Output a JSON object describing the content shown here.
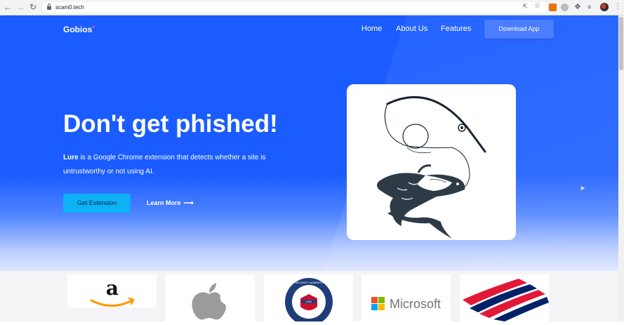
{
  "browser": {
    "url": "scam0.tech",
    "icons": [
      "back-icon",
      "forward-icon",
      "reload-icon",
      "lock-icon",
      "share-icon",
      "star-icon",
      "extension-icon",
      "puzzle-icon",
      "media-icon",
      "avatar",
      "menu-icon"
    ]
  },
  "nav": {
    "logo": "Gobios",
    "logo_mark": "*",
    "links": [
      "Home",
      "About Us",
      "Features"
    ],
    "download_label": "Download App"
  },
  "hero": {
    "headline": "Don't get phished!",
    "desc_bold": "Lure",
    "desc_rest": " is a Google Chrome extension that detects whether a site is untrustworthy or not using AI.",
    "primary_button": "Get Extension",
    "secondary_link": "Learn More",
    "image": "fishing-hook-fish-illustration"
  },
  "partners": {
    "microsoft_label": "Microsoft",
    "ssa_label": "SOCIAL SECURITY ADMINISTRATION",
    "ssa_center": "USA",
    "logos": [
      "amazon-logo",
      "apple-logo",
      "social-security-administration-logo",
      "microsoft-logo",
      "bank-of-america-logo"
    ]
  },
  "colors": {
    "hero_blue": "#1a5cff",
    "download_button": "#4a7dff",
    "extension_button": "#0db2f5",
    "amazon_orange": "#ff9900",
    "ssa_navy": "#1f3d7a",
    "boa_red": "#e31837",
    "boa_blue": "#012169"
  }
}
